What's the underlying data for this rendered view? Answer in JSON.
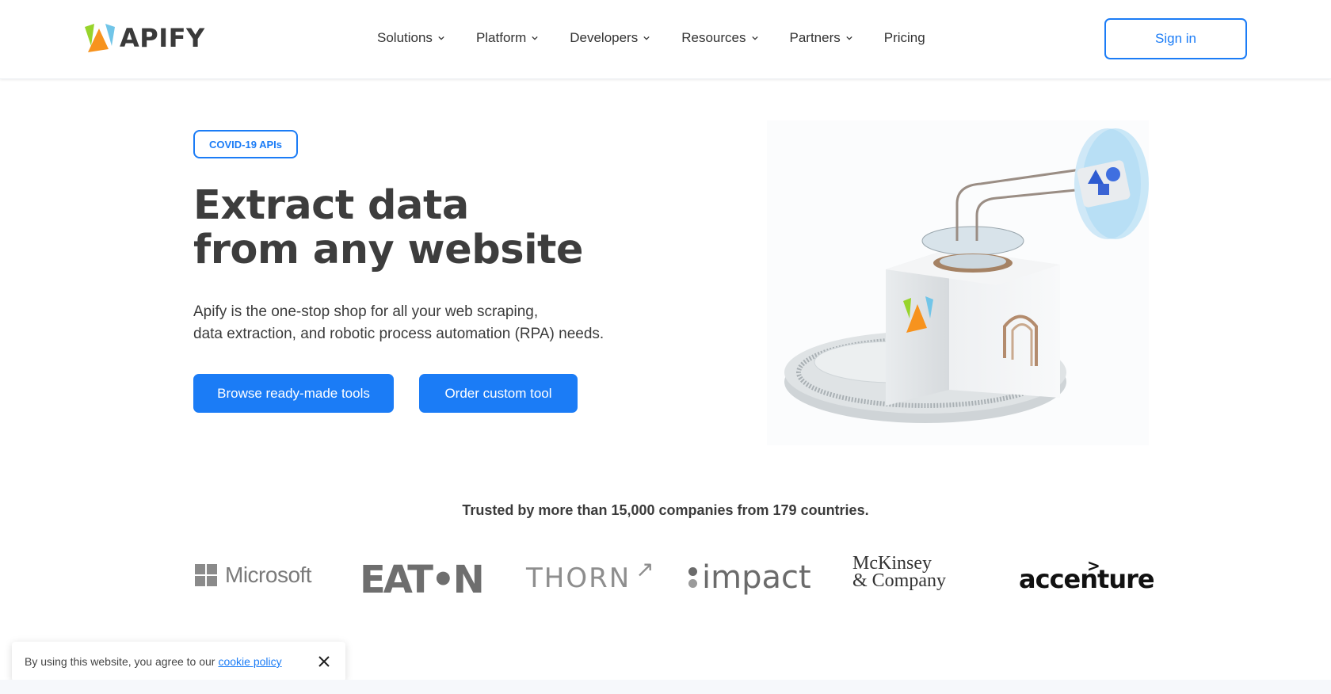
{
  "header": {
    "logo_text": "APIFY",
    "nav": [
      {
        "label": "Solutions",
        "has_dropdown": true
      },
      {
        "label": "Platform",
        "has_dropdown": true
      },
      {
        "label": "Developers",
        "has_dropdown": true
      },
      {
        "label": "Resources",
        "has_dropdown": true
      },
      {
        "label": "Partners",
        "has_dropdown": true
      },
      {
        "label": "Pricing",
        "has_dropdown": false
      }
    ],
    "signin_label": "Sign in"
  },
  "hero": {
    "badge": "COVID-19 APIs",
    "headline_line1": "Extract data",
    "headline_line2": "from any website",
    "subtext_line1": "Apify is the one-stop shop for all your web scraping,",
    "subtext_line2": "data extraction, and robotic process automation (RPA) needs.",
    "browse_button": "Browse ready-made tools",
    "order_button": "Order custom tool"
  },
  "trusted": {
    "text": "Trusted by more than 15,000 companies from 179 countries.",
    "logos": {
      "microsoft": "Microsoft",
      "eaton": "EAT•N",
      "thorn": "THORN",
      "impact": "impact",
      "mckinsey_line1": "McKinsey",
      "mckinsey_line2": "& Company",
      "accenture": "accenture"
    }
  },
  "cookie": {
    "text": "By using this website, you agree to our",
    "link": "cookie policy"
  },
  "colors": {
    "accent": "#1b7cf6",
    "heading": "#3d3d3d",
    "text": "#3b3b3b"
  }
}
